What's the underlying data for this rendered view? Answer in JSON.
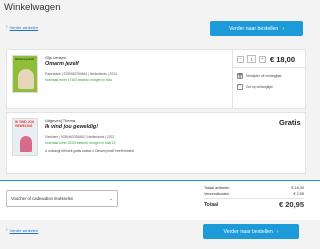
{
  "page": {
    "title": "Winkelwagen"
  },
  "nav": {
    "back_label": "Verder winkelen",
    "checkout_label": "Verder naar bestellen"
  },
  "items": [
    {
      "author": "Gijs Lensen",
      "title": "Omarm jezelf",
      "meta": "Paperback | 9789463750661 | Nederlands | 2024",
      "stock": "Voorraad meer 17400 besteld, morgen in huis",
      "cover_text": "Omarm jezelf",
      "quantity": "1",
      "price": "€ 18,00",
      "action_wishlist": "Verwijder uit verlanglijst",
      "action_save": "Zet op verlanglijst"
    },
    {
      "author": "Uitgeverij Thema",
      "title": "Ik vind jou geweldig!",
      "meta": "Gesloten | 9789463750662 | Nederlands | 2022",
      "stock": "Voorraad meer 23:00 besteld, morgen in huis 22",
      "cover_text": "IK VIND JOU GEWELDIG",
      "note": "U ontvangt dit boek gratis omdat u 'Omarm jezelf' heeft besteld",
      "price": "Gratis"
    }
  ],
  "voucher": {
    "label": "Voucher of cadeaubon inwisselen"
  },
  "summary": {
    "articles_label": "Totaal artikelen",
    "articles_value": "€ 18,00",
    "shipping_label": "Verzendkosten",
    "shipping_value": "€ 2,95",
    "total_label": "Totaal",
    "total_value": "€ 20,95"
  },
  "colors": {
    "accent": "#1c9bd8",
    "stock_green": "#2d9b2d"
  }
}
